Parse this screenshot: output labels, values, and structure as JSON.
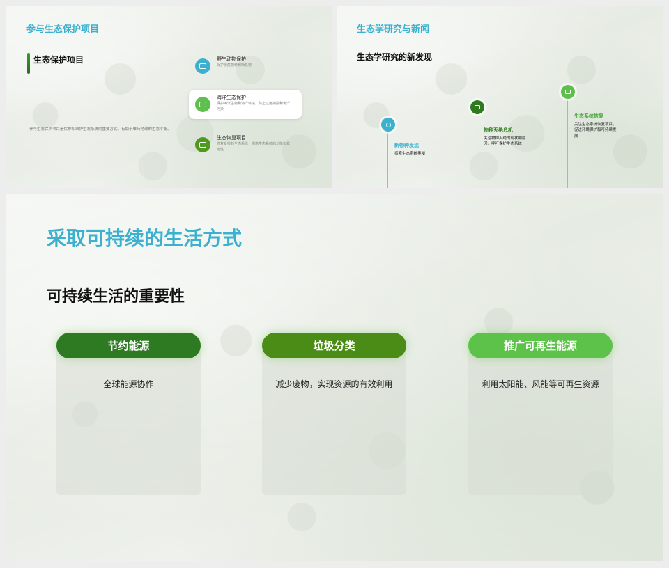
{
  "slide1": {
    "title": "参与生态保护项目",
    "subtitle": "生态保护项目",
    "description": "参与生态保护项目是保护和维护生态系统的重要方式，有助于维持地球的生态平衡。",
    "items": [
      {
        "title": "野生动物保护",
        "desc": "保护濒危物种和栖息地",
        "color": "#3cb1cf",
        "icon": "camera-icon"
      },
      {
        "title": "海洋生态保护",
        "desc": "保护海洋生物和海洋环境，防止过度捕捞和海洋污染",
        "color": "#5fbf4e",
        "icon": "car-icon"
      },
      {
        "title": "生态恢复项目",
        "desc": "修复受损的生态系统，提高生态系统的功能和稳定性",
        "color": "#4e9a1e",
        "icon": "chat-icon"
      }
    ]
  },
  "slide2": {
    "title": "生态学研究与新闻",
    "subtitle": "生态学研究的新发现",
    "timeline": [
      {
        "title": "新物种发现",
        "desc": "探索生态系统奥秘",
        "color": "#3cb1cf",
        "icon": "pin-icon"
      },
      {
        "title": "物种灭绝危机",
        "desc": "关注物种灭绝的现状和原因，呼吁保护生态系统",
        "color": "#2d7a1f",
        "icon": "network-icon"
      },
      {
        "title": "生态系统恢复",
        "desc": "关注生态系统恢复项目，促进环境保护和可持续发展",
        "color": "#5fbf4e",
        "icon": "image-icon"
      }
    ]
  },
  "slide3": {
    "title": "采取可持续的生活方式",
    "subtitle": "可持续生活的重要性",
    "cards": [
      {
        "heading": "节约能源",
        "text": "全球能源协作",
        "color": "#2e7a22"
      },
      {
        "heading": "垃圾分类",
        "text": "减少废物，实现资源的有效利用",
        "color": "#4a8c16"
      },
      {
        "heading": "推广可再生能源",
        "text": "利用太阳能、风能等可再生资源",
        "color": "#5cc24a"
      }
    ]
  }
}
